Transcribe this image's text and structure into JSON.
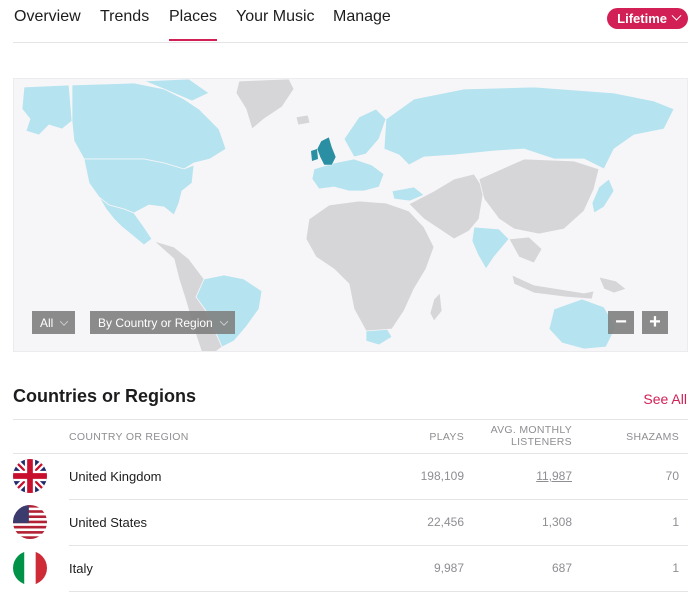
{
  "nav": {
    "tabs": [
      {
        "label": "Overview",
        "active": false
      },
      {
        "label": "Trends",
        "active": false
      },
      {
        "label": "Places",
        "active": true
      },
      {
        "label": "Your Music",
        "active": false
      },
      {
        "label": "Manage",
        "active": false
      }
    ],
    "period_label": "Lifetime"
  },
  "map": {
    "filter_label": "All",
    "group_label": "By Country or Region",
    "zoom_out": "−",
    "zoom_in": "+",
    "colors": {
      "ocean": "#f6f6f8",
      "no_data": "#d6d6d8",
      "low": "#b5e3ef",
      "high": "#2a8fa3"
    },
    "highlighted_regions": [
      "United Kingdom",
      "United States",
      "Canada",
      "Brazil",
      "Russia",
      "India",
      "Australia",
      "Turkey",
      "South Africa",
      "Mexico",
      "Europe"
    ]
  },
  "section": {
    "title": "Countries or Regions",
    "see_all": "See All"
  },
  "table": {
    "headers": {
      "country": "COUNTRY OR REGION",
      "plays": "PLAYS",
      "listeners_line1": "AVG. MONTHLY",
      "listeners_line2": "LISTENERS",
      "shazams": "SHAZAMS"
    },
    "rows": [
      {
        "flag": "uk-flag",
        "country": "United Kingdom",
        "plays": "198,109",
        "listeners": "11,987",
        "shazams": "70"
      },
      {
        "flag": "us-flag",
        "country": "United States",
        "plays": "22,456",
        "listeners": "1,308",
        "shazams": "1"
      },
      {
        "flag": "italy-flag",
        "country": "Italy",
        "plays": "9,987",
        "listeners": "687",
        "shazams": "1"
      }
    ]
  }
}
